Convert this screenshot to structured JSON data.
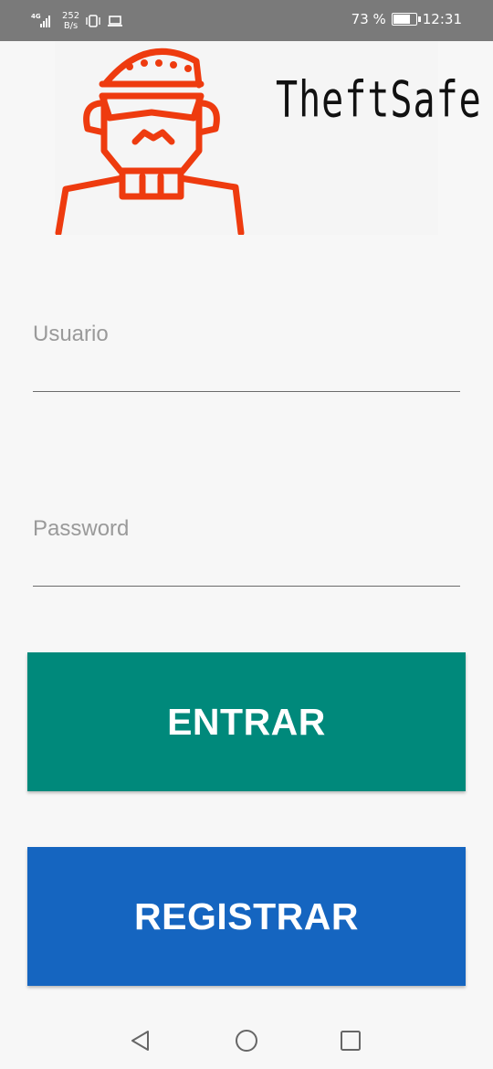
{
  "status_bar": {
    "network_type": "4G",
    "data_speed_value": "252",
    "data_speed_unit": "B/s",
    "battery_percent": "73 %",
    "time": "12:31",
    "icons": [
      "signal-icon",
      "vibrate-icon",
      "laptop-icon",
      "battery-icon"
    ]
  },
  "logo": {
    "brand_text": "TheftSafe",
    "mascot_color": "#ee3b0f"
  },
  "form": {
    "username_placeholder": "Usuario",
    "password_placeholder": "Password"
  },
  "buttons": {
    "login_label": "ENTRAR",
    "register_label": "REGISTRAR",
    "login_color": "#00897b",
    "register_color": "#1565c0"
  },
  "nav_bar": {
    "icons": [
      "back-icon",
      "home-icon",
      "recents-icon"
    ]
  }
}
